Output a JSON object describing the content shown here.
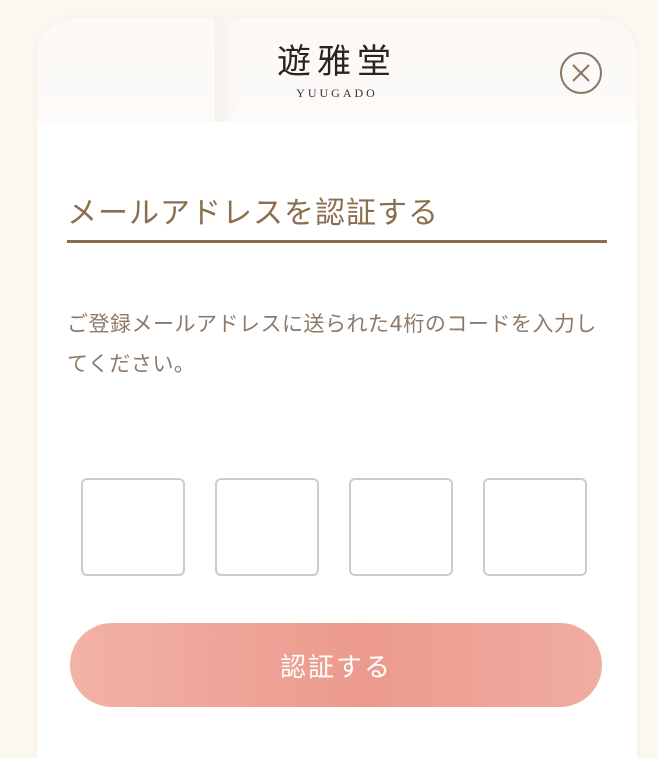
{
  "brand": {
    "logo_kanji": "遊雅堂",
    "logo_roman": "YUUGADO"
  },
  "header": {
    "close_icon": "close-circle-icon"
  },
  "main": {
    "title": "メールアドレスを認証する",
    "description": "ご登録メールアドレスに送られた4桁のコードを入力してください。",
    "code_inputs": [
      "",
      "",
      "",
      ""
    ],
    "submit_label": "認証する"
  },
  "colors": {
    "accent_brown": "#8b6e4e",
    "button_coral": "#ec9a8d",
    "background": "#fdf7f1"
  }
}
